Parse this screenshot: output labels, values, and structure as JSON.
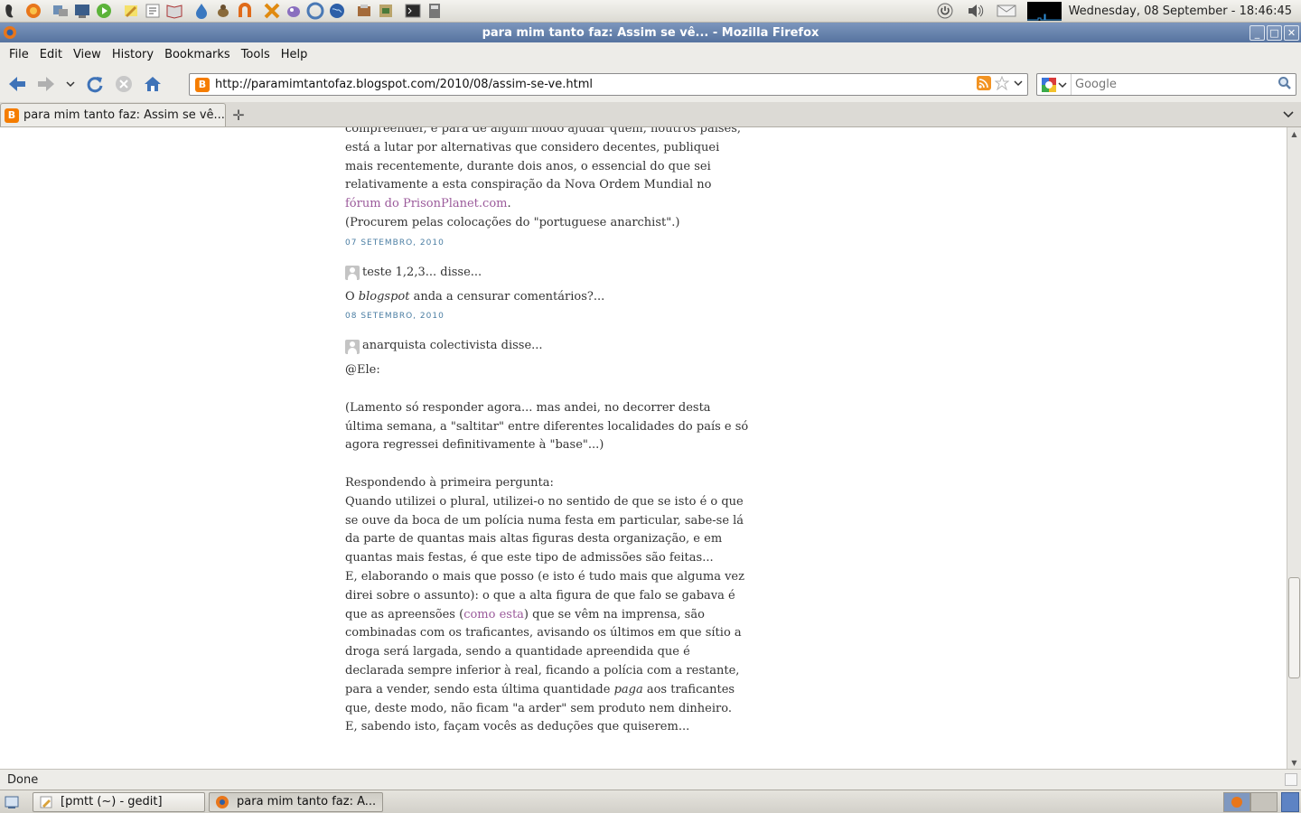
{
  "panel": {
    "launchers": [
      "gnome-foot-icon",
      "firefox-icon",
      "network-tools-icon",
      "system-monitor-icon",
      "media-player-icon",
      "text-editor-icon",
      "notes-icon",
      "dictionary-icon",
      "bittorrent-icon",
      "gimp-icon",
      "app-icon",
      "x-chat-icon",
      "pidgin-icon",
      "web-browser-icon",
      "globe-icon",
      "package-manager-icon",
      "archive-icon",
      "terminal-icon",
      "calculator-icon"
    ],
    "clock": "Wednesday, 08 September - 18:46:45"
  },
  "window": {
    "title": "para mim tanto faz: Assim se vê... - Mozilla Firefox"
  },
  "menubar": {
    "items": [
      "File",
      "Edit",
      "View",
      "History",
      "Bookmarks",
      "Tools",
      "Help"
    ]
  },
  "navbar": {
    "url": "http://paramimtantofaz.blogspot.com/2010/08/assim-se-ve.html",
    "search_placeholder": "Google"
  },
  "tabs": {
    "active_label": "para mim tanto faz: Assim se vê..."
  },
  "content": {
    "top_lines": [
      "compreender, e para de algum modo ajudar quem, noutros países,",
      "está a lutar por alternativas que considero decentes, publiquei",
      "mais recentemente, durante dois anos, o essencial do que sei",
      "relativamente a esta conspiração da Nova Ordem Mundial no"
    ],
    "forum_link": "fórum do PrisonPlanet.com",
    "forum_after": ".",
    "procurem": "(Procurem pelas colocações do \"portuguese anarchist\".)",
    "date1": "07 SETEMBRO, 2010",
    "comment2": {
      "author": "teste 1,2,3... disse...",
      "text_pre": "O ",
      "text_em": "blogspot",
      "text_post": " anda a censurar comentários?..."
    },
    "date2": "08 SETEMBRO, 2010",
    "comment3": {
      "author": "anarquista colectivista disse...",
      "greeting": "@Ele:",
      "lament_lines": [
        "(Lamento só responder agora... mas andei, no decorrer desta",
        "última semana, a \"saltitar\" entre diferentes localidades do país e só",
        "agora regressei definitivamente à \"base\"...)"
      ],
      "respondendo": "Respondendo à primeira pergunta:",
      "plural_lines": [
        "Quando utilizei o plural, utilizei-o no sentido de que se isto é o que",
        "se ouve da boca de um polícia numa festa em particular, sabe-se lá",
        "da parte de quantas mais altas figuras desta organização, e em",
        "quantas mais festas, é que este tipo de admissões são feitas...",
        "E, elaborando o mais que posso (e isto é tudo mais que alguma vez",
        "direi sobre o assunto): o que a alta figura de que falo se gabava é"
      ],
      "link_line_pre": "que as apreensões (",
      "link_text": "como esta",
      "link_line_post": ") que se vêm na imprensa, são",
      "mid_lines": [
        "combinadas com os traficantes, avisando os últimos em que sítio a",
        "droga será largada, sendo a quantidade apreendida que é",
        "declarada sempre inferior à real, ficando a polícia com a restante,"
      ],
      "paga_pre": "para a vender, sendo esta última quantidade ",
      "paga_em": "paga",
      "paga_post": " aos traficantes",
      "end_lines": [
        "que, deste modo, não ficam \"a arder\" sem produto nem dinheiro.",
        "E, sabendo isto, façam vocês as deduções que quiserem..."
      ]
    }
  },
  "statusbar": {
    "text": "Done"
  },
  "taskbar": {
    "tasks": [
      "[pmtt (~) - gedit]",
      "para mim tanto faz: A..."
    ]
  },
  "colors": {
    "title_bar": "#56739f",
    "link": "#9b5a9b",
    "date": "#4b7ea3",
    "blogger_orange": "#f57d00"
  }
}
